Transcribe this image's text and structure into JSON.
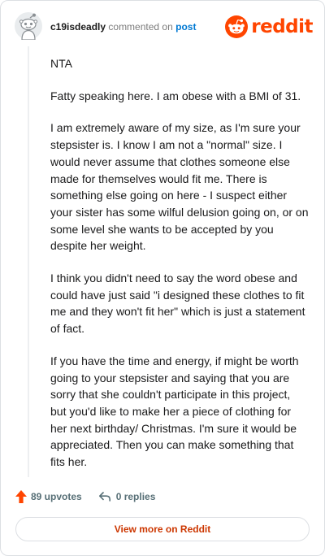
{
  "comment": {
    "username": "c19isdeadly",
    "verb": "commented on",
    "post_link": "post",
    "body": [
      "NTA",
      "Fatty speaking here. I am obese with a BMI of 31.",
      "I am extremely aware of my size, as I'm sure your stepsister is. I know I am not a \"normal\" size. I would never assume that clothes someone else made for themselves would fit me. There is something else going on here - I suspect either your sister has some wilful delusion going on, or on some level she wants to be accepted by you despite her weight.",
      "I think you didn't need to say the word obese and could have just said \"i designed these clothes to fit me and they won't fit her\" which is just a statement of fact.",
      "If you have the time and energy, if might be worth going to your stepsister and saying that you are sorry that she couldn't participate in this project, but you'd like to make her a piece of clothing for her next birthday/ Christmas. I'm sure it would be appreciated. Then you can make something that fits her."
    ],
    "upvotes_label": "89 upvotes",
    "replies_label": "0 replies"
  },
  "brand": {
    "logo_text": "reddit",
    "accent": "#ff4500",
    "link_color": "#0079d3"
  },
  "footer": {
    "view_more_label": "View more on Reddit"
  },
  "icons": {
    "avatar": "snoo-avatar-icon",
    "logo": "reddit-snoo-icon",
    "upvote": "upvote-arrow-icon",
    "reply": "reply-arrow-icon"
  }
}
